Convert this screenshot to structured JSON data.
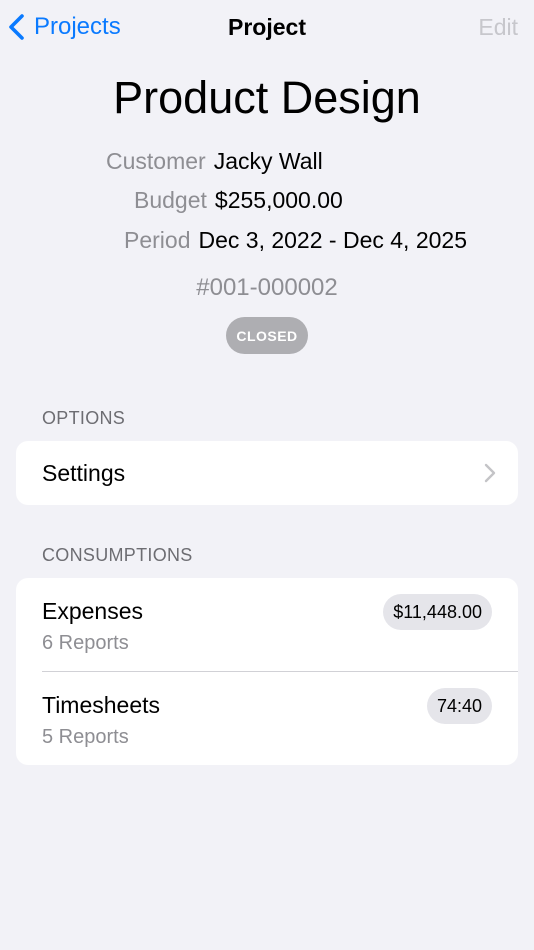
{
  "nav": {
    "back_label": "Projects",
    "title": "Project",
    "edit_label": "Edit"
  },
  "project": {
    "name": "Product Design",
    "customer_label": "Customer",
    "customer": "Jacky Wall",
    "budget_label": "Budget",
    "budget": "$255,000.00",
    "period_label": "Period",
    "period": "Dec 3, 2022 - Dec 4, 2025",
    "number": "#001-000002",
    "status": "CLOSED"
  },
  "options": {
    "header": "OPTIONS",
    "settings_label": "Settings"
  },
  "consumptions": {
    "header": "CONSUMPTIONS",
    "items": [
      {
        "title": "Expenses",
        "subtitle": "6 Reports",
        "value": "$11,448.00"
      },
      {
        "title": "Timesheets",
        "subtitle": "5 Reports",
        "value": "74:40"
      }
    ]
  },
  "colors": {
    "accent": "#0a7aff",
    "background": "#f2f2f7",
    "status_badge": "#aeaeb2"
  },
  "icons": {
    "back": "chevron-left-icon",
    "disclosure": "chevron-right-icon"
  }
}
